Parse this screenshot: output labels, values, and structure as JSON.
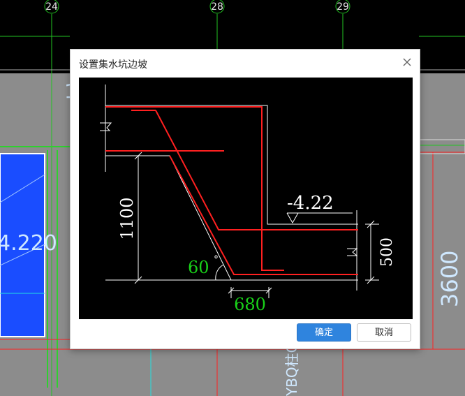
{
  "cad_background": {
    "axis_labels": [
      "24",
      "28",
      "29"
    ],
    "elevation_label": "4.220",
    "side_dimension": "3600",
    "vertical_text": "YBQ柱C"
  },
  "dialog": {
    "title": "设置集水坑边坡",
    "confirm_label": "确定",
    "cancel_label": "取消",
    "diagram": {
      "elevation": "-4.22",
      "height_left": "1100",
      "height_right": "500",
      "angle": "60",
      "degree_mark": "°",
      "bottom_width": "680"
    }
  },
  "colors": {
    "accent": "#2f84de",
    "rebar": "#ff2020",
    "dimension_text": "#19d119",
    "cad_blue": "#1a4dff"
  }
}
